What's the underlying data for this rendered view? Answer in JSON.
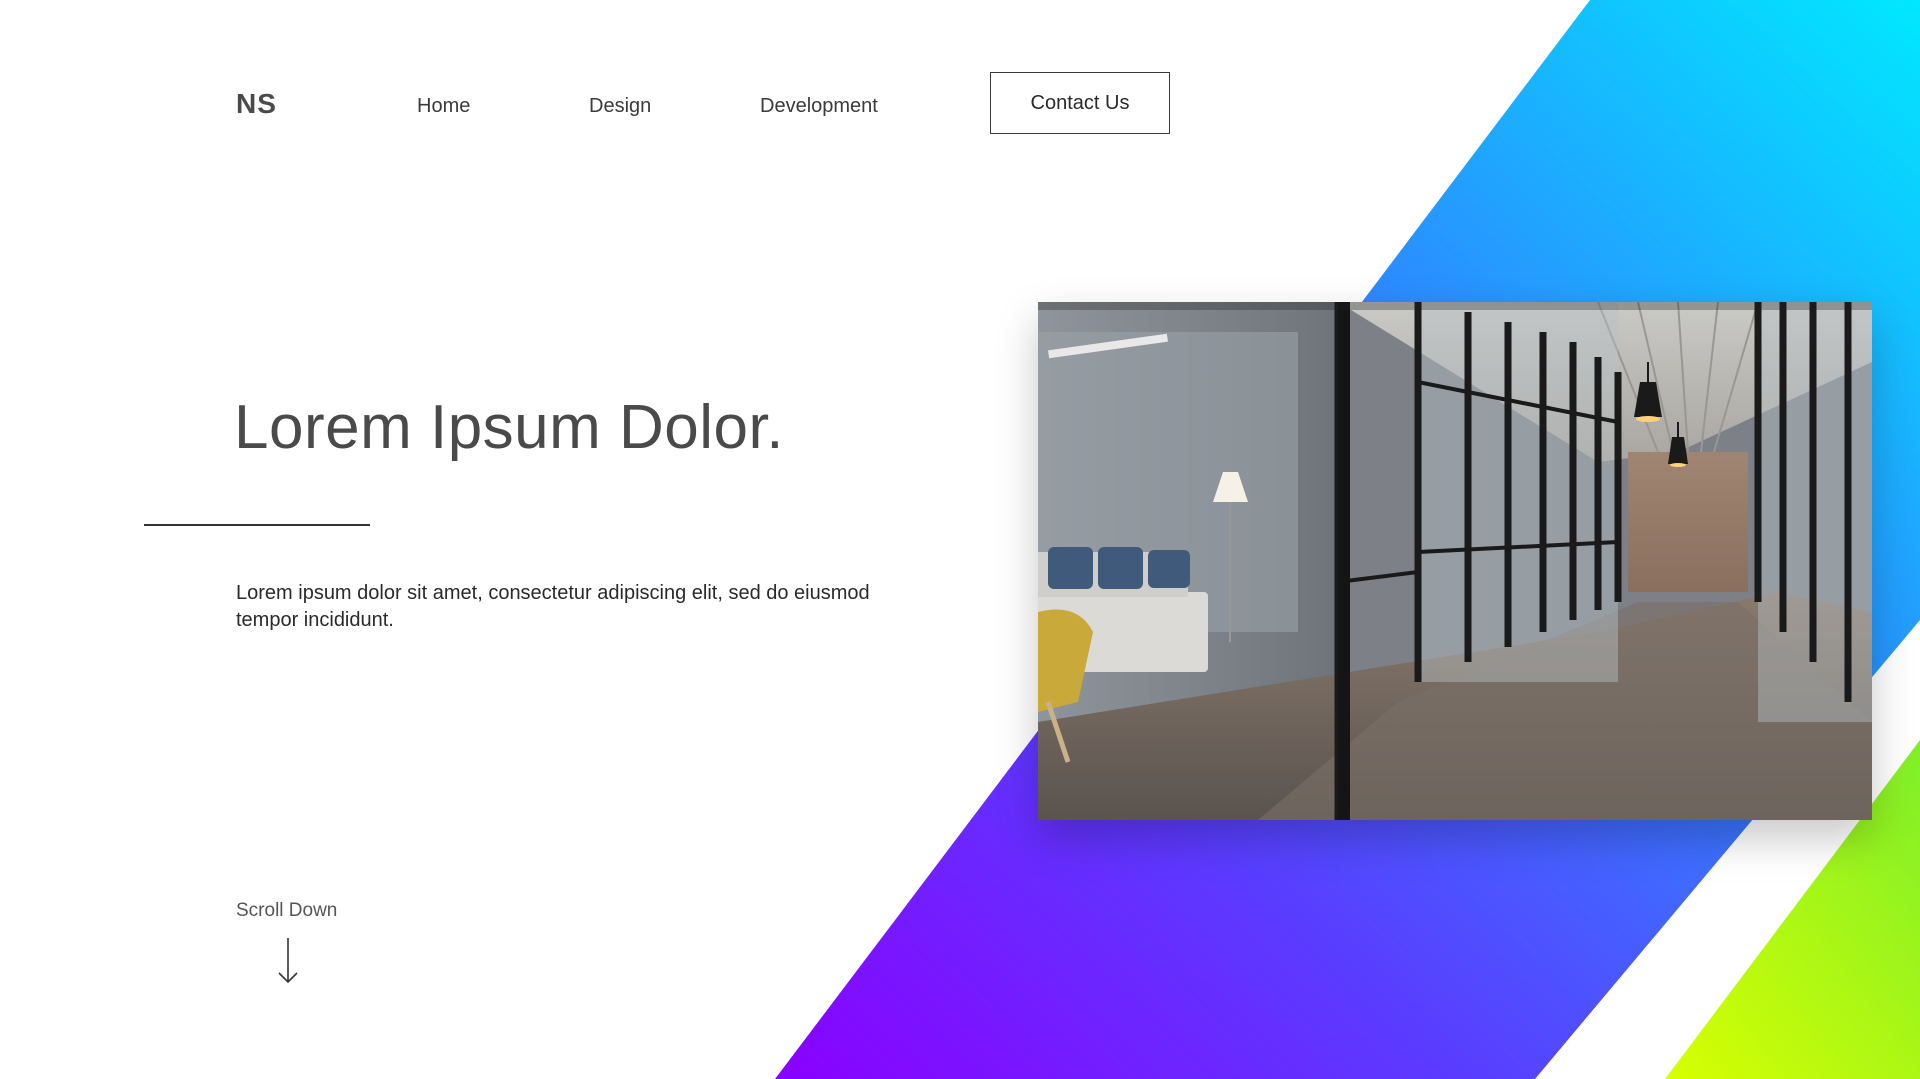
{
  "brand": {
    "logo": "NS"
  },
  "nav": {
    "items": [
      {
        "label": "Home"
      },
      {
        "label": "Design"
      },
      {
        "label": "Development"
      }
    ],
    "contact_label": "Contact Us"
  },
  "hero": {
    "headline": "Lorem Ipsum Dolor.",
    "body": "Lorem ipsum dolor sit amet, consectetur adipiscing elit, sed do eiusmod tempor incididunt.",
    "scroll_label": "Scroll Down",
    "image_subject": "modern office corridor with glass walls"
  },
  "colors": {
    "gradient_top": "#00e5ff",
    "gradient_mid": "#2b8cff",
    "gradient_bottom": "#8a00ff",
    "lime_top": "#8ff51f",
    "lime_bottom": "#d4ff00",
    "text": "#444444"
  },
  "icons": {
    "scroll": "arrow-down-icon"
  }
}
